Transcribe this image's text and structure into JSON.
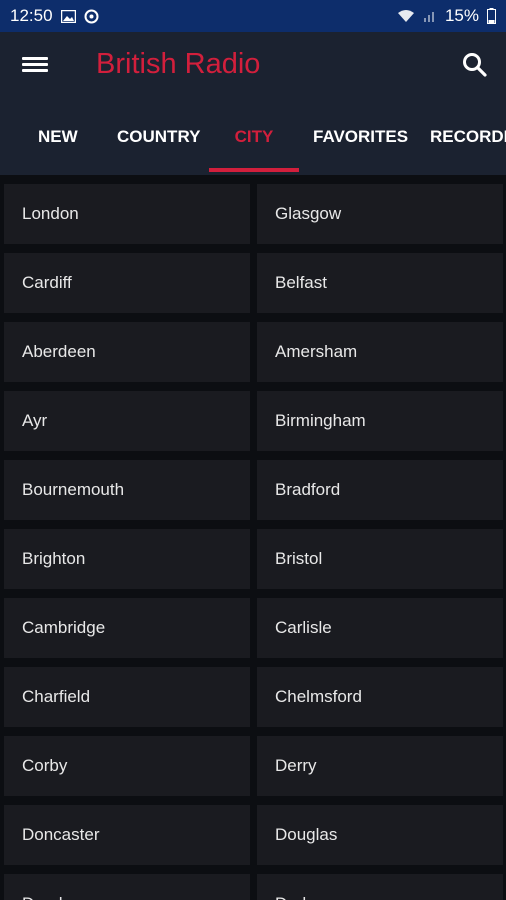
{
  "status_bar": {
    "time": "12:50",
    "battery": "15%",
    "icons": [
      "image-icon",
      "vpn-icon",
      "wifi-icon",
      "signal-icon",
      "battery-icon"
    ]
  },
  "app": {
    "title": "British Radio",
    "menu_icon": "hamburger-menu-icon",
    "search_icon": "search-icon",
    "accent_color": "#d21f3c"
  },
  "tabs": [
    {
      "label": "NEW",
      "active": false
    },
    {
      "label": "COUNTRY",
      "active": false
    },
    {
      "label": "CITY",
      "active": true
    },
    {
      "label": "FAVORITES",
      "active": false
    },
    {
      "label": "RECORDE",
      "active": false
    }
  ],
  "cities": [
    "London",
    "Glasgow",
    "Cardiff",
    "Belfast",
    "Aberdeen",
    "Amersham",
    "Ayr",
    "Birmingham",
    "Bournemouth",
    "Bradford",
    "Brighton",
    "Bristol",
    "Cambridge",
    "Carlisle",
    "Charfield",
    "Chelmsford",
    "Corby",
    "Derry",
    "Doncaster",
    "Douglas",
    "Dundee",
    "Durham"
  ]
}
